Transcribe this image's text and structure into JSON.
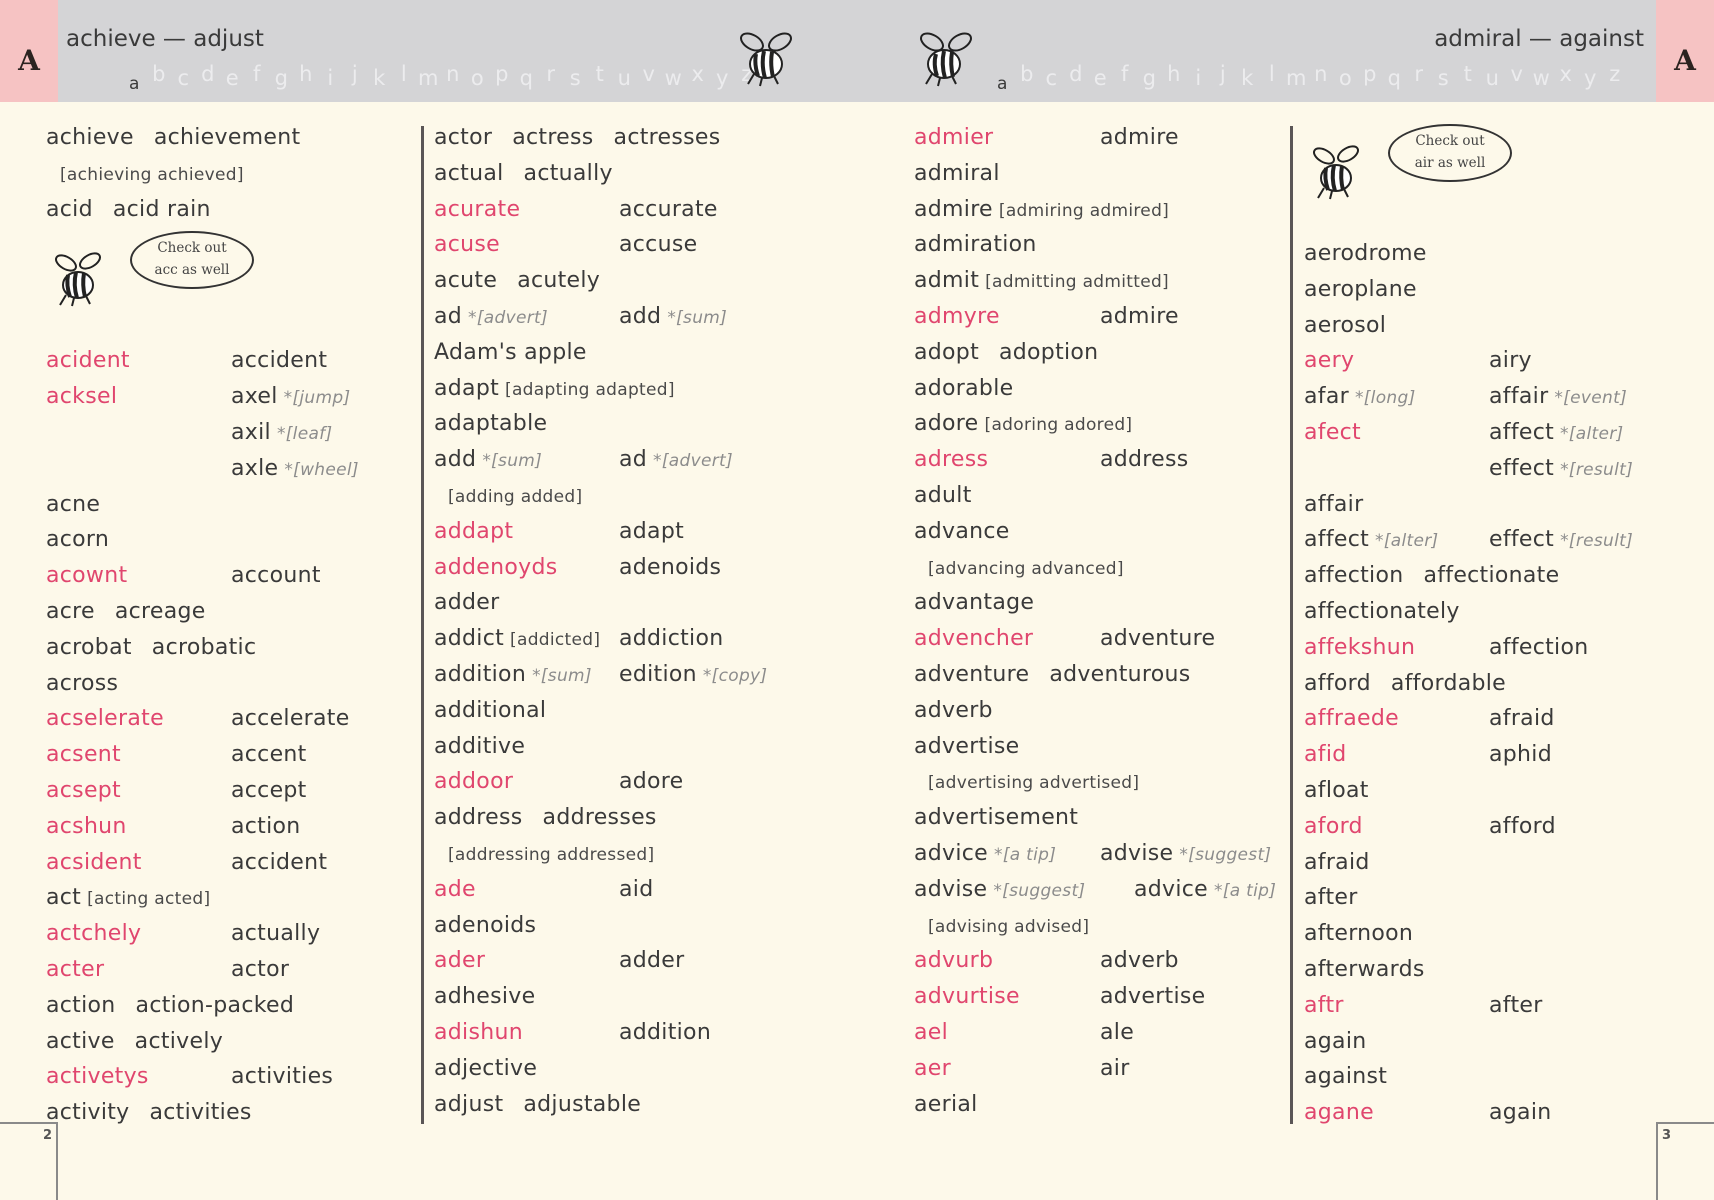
{
  "left_page": {
    "tab_letter": "A",
    "guide_words": "achieve — adjust",
    "alphabet": [
      "a",
      "b",
      "c",
      "d",
      "e",
      "f",
      "g",
      "h",
      "i",
      "j",
      "k",
      "l",
      "m",
      "n",
      "o",
      "p",
      "q",
      "r",
      "s",
      "t",
      "u",
      "v",
      "w",
      "x",
      "y",
      "z"
    ],
    "active_letter": "a",
    "page_number": "2",
    "callout": {
      "line1": "Check out",
      "line2": "acc as well"
    },
    "col1": [
      {
        "type": "multi",
        "words": [
          "achieve",
          "achievement"
        ]
      },
      {
        "type": "sub",
        "forms": "[achieving achieved]"
      },
      {
        "type": "multi",
        "words": [
          "acid",
          "acid rain"
        ]
      },
      {
        "type": "callout"
      },
      {
        "type": "pair",
        "miss": "acident",
        "correct": "accident"
      },
      {
        "type": "pair",
        "miss": "acksel",
        "correct": "axel",
        "note": "*[jump]"
      },
      {
        "type": "pair",
        "miss": "",
        "correct": "axil",
        "note": "*[leaf]"
      },
      {
        "type": "pair",
        "miss": "",
        "correct": "axle",
        "note": "*[wheel]"
      },
      {
        "type": "multi",
        "words": [
          "acne"
        ]
      },
      {
        "type": "multi",
        "words": [
          "acorn"
        ]
      },
      {
        "type": "pair",
        "miss": "acownt",
        "correct": "account"
      },
      {
        "type": "multi",
        "words": [
          "acre",
          "acreage"
        ]
      },
      {
        "type": "multi",
        "words": [
          "acrobat",
          "acrobatic"
        ]
      },
      {
        "type": "multi",
        "words": [
          "across"
        ]
      },
      {
        "type": "pair",
        "miss": "acselerate",
        "correct": "accelerate"
      },
      {
        "type": "pair",
        "miss": "acsent",
        "correct": "accent"
      },
      {
        "type": "pair",
        "miss": "acsept",
        "correct": "accept"
      },
      {
        "type": "pair",
        "miss": "acshun",
        "correct": "action"
      },
      {
        "type": "pair",
        "miss": "acsident",
        "correct": "accident"
      },
      {
        "type": "inline",
        "word": "act",
        "forms": "[acting acted]"
      },
      {
        "type": "pair",
        "miss": "actchely",
        "correct": "actually"
      },
      {
        "type": "pair",
        "miss": "acter",
        "correct": "actor"
      },
      {
        "type": "multi",
        "words": [
          "action",
          "action-packed"
        ]
      },
      {
        "type": "multi",
        "words": [
          "active",
          "actively"
        ]
      },
      {
        "type": "pair",
        "miss": "activetys",
        "correct": "activities"
      },
      {
        "type": "multi",
        "words": [
          "activity",
          "activities"
        ]
      }
    ],
    "col2": [
      {
        "type": "multi",
        "words": [
          "actor",
          "actress",
          "actresses"
        ]
      },
      {
        "type": "multi",
        "words": [
          "actual",
          "actually"
        ]
      },
      {
        "type": "pair",
        "miss": "acurate",
        "correct": "accurate"
      },
      {
        "type": "pair",
        "miss": "acuse",
        "correct": "accuse"
      },
      {
        "type": "multi",
        "words": [
          "acute",
          "acutely"
        ]
      },
      {
        "type": "pairn",
        "left": "ad",
        "left_note": "*[advert]",
        "correct": "add",
        "note": "*[sum]"
      },
      {
        "type": "multi",
        "words": [
          "Adam's apple"
        ]
      },
      {
        "type": "inline",
        "word": "adapt",
        "forms": "[adapting adapted]"
      },
      {
        "type": "multi",
        "words": [
          "adaptable"
        ]
      },
      {
        "type": "pairn",
        "left": "add",
        "left_note": "*[sum]",
        "correct": "ad",
        "note": "*[advert]"
      },
      {
        "type": "sub",
        "forms": "[adding added]"
      },
      {
        "type": "pair",
        "miss": "addapt",
        "correct": "adapt"
      },
      {
        "type": "pair",
        "miss": "addenoyds",
        "correct": "adenoids"
      },
      {
        "type": "multi",
        "words": [
          "adder"
        ]
      },
      {
        "type": "pairf",
        "left": "addict",
        "left_forms": "[addicted]",
        "correct": "addiction"
      },
      {
        "type": "pairn",
        "left": "addition",
        "left_note": "*[sum]",
        "correct": "edition",
        "note": "*[copy]"
      },
      {
        "type": "multi",
        "words": [
          "additional"
        ]
      },
      {
        "type": "multi",
        "words": [
          "additive"
        ]
      },
      {
        "type": "pair",
        "miss": "addoor",
        "correct": "adore"
      },
      {
        "type": "multi",
        "words": [
          "address",
          "addresses"
        ]
      },
      {
        "type": "sub",
        "forms": "[addressing addressed]"
      },
      {
        "type": "pair",
        "miss": "ade",
        "correct": "aid"
      },
      {
        "type": "multi",
        "words": [
          "adenoids"
        ]
      },
      {
        "type": "pair",
        "miss": "ader",
        "correct": "adder"
      },
      {
        "type": "multi",
        "words": [
          "adhesive"
        ]
      },
      {
        "type": "pair",
        "miss": "adishun",
        "correct": "addition"
      },
      {
        "type": "multi",
        "words": [
          "adjective"
        ]
      },
      {
        "type": "multi",
        "words": [
          "adjust",
          "adjustable"
        ]
      }
    ]
  },
  "right_page": {
    "tab_letter": "A",
    "guide_words": "admiral — against",
    "alphabet": [
      "a",
      "b",
      "c",
      "d",
      "e",
      "f",
      "g",
      "h",
      "i",
      "j",
      "k",
      "l",
      "m",
      "n",
      "o",
      "p",
      "q",
      "r",
      "s",
      "t",
      "u",
      "v",
      "w",
      "x",
      "y",
      "z"
    ],
    "active_letter": "a",
    "page_number": "3",
    "callout": {
      "line1": "Check out",
      "line2": "air as well"
    },
    "col3": [
      {
        "type": "pair",
        "miss": "admier",
        "correct": "admire"
      },
      {
        "type": "multi",
        "words": [
          "admiral"
        ]
      },
      {
        "type": "inline",
        "word": "admire",
        "forms": "[admiring admired]"
      },
      {
        "type": "multi",
        "words": [
          "admiration"
        ]
      },
      {
        "type": "inline",
        "word": "admit",
        "forms": "[admitting admitted]"
      },
      {
        "type": "pair",
        "miss": "admyre",
        "correct": "admire"
      },
      {
        "type": "multi",
        "words": [
          "adopt",
          "adoption"
        ]
      },
      {
        "type": "multi",
        "words": [
          "adorable"
        ]
      },
      {
        "type": "inline",
        "word": "adore",
        "forms": "[adoring adored]"
      },
      {
        "type": "pair",
        "miss": "adress",
        "correct": "address"
      },
      {
        "type": "multi",
        "words": [
          "adult"
        ]
      },
      {
        "type": "multi",
        "words": [
          "advance"
        ]
      },
      {
        "type": "sub",
        "forms": "[advancing advanced]"
      },
      {
        "type": "multi",
        "words": [
          "advantage"
        ]
      },
      {
        "type": "pair",
        "miss": "advencher",
        "correct": "adventure"
      },
      {
        "type": "multi",
        "words": [
          "adventure",
          "adventurous"
        ]
      },
      {
        "type": "multi",
        "words": [
          "adverb"
        ]
      },
      {
        "type": "multi",
        "words": [
          "advertise"
        ]
      },
      {
        "type": "sub",
        "forms": "[advertising advertised]"
      },
      {
        "type": "multi",
        "words": [
          "advertisement"
        ]
      },
      {
        "type": "pairn",
        "left": "advice",
        "left_note": "*[a tip]",
        "correct": "advise",
        "note": "*[suggest]"
      },
      {
        "type": "pairn",
        "left": "advise",
        "left_note": "*[suggest]",
        "correct": "advice",
        "note": "*[a tip]",
        "wide": true
      },
      {
        "type": "sub",
        "forms": "[advising advised]"
      },
      {
        "type": "pair",
        "miss": "advurb",
        "correct": "adverb"
      },
      {
        "type": "pair",
        "miss": "advurtise",
        "correct": "advertise"
      },
      {
        "type": "pair",
        "miss": "ael",
        "correct": "ale"
      },
      {
        "type": "pair",
        "miss": "aer",
        "correct": "air"
      },
      {
        "type": "multi",
        "words": [
          "aerial"
        ]
      }
    ],
    "col4": [
      {
        "type": "callout"
      },
      {
        "type": "multi",
        "words": [
          "aerodrome"
        ]
      },
      {
        "type": "multi",
        "words": [
          "aeroplane"
        ]
      },
      {
        "type": "multi",
        "words": [
          "aerosol"
        ]
      },
      {
        "type": "pair",
        "miss": "aery",
        "correct": "airy"
      },
      {
        "type": "pairn",
        "left": "afar",
        "left_note": "*[long]",
        "correct": "affair",
        "note": "*[event]"
      },
      {
        "type": "pair",
        "miss": "afect",
        "correct": "affect",
        "note": "*[alter]"
      },
      {
        "type": "pair",
        "miss": "",
        "correct": "effect",
        "note": "*[result]"
      },
      {
        "type": "multi",
        "words": [
          "affair"
        ]
      },
      {
        "type": "pairn",
        "left": "affect",
        "left_note": "*[alter]",
        "correct": "effect",
        "note": "*[result]"
      },
      {
        "type": "multi",
        "words": [
          "affection",
          "affectionate"
        ]
      },
      {
        "type": "multi",
        "words": [
          "affectionately"
        ]
      },
      {
        "type": "pair",
        "miss": "affekshun",
        "correct": "affection"
      },
      {
        "type": "multi",
        "words": [
          "afford",
          "affordable"
        ]
      },
      {
        "type": "pair",
        "miss": "affraede",
        "correct": "afraid"
      },
      {
        "type": "pair",
        "miss": "afid",
        "correct": "aphid"
      },
      {
        "type": "multi",
        "words": [
          "afloat"
        ]
      },
      {
        "type": "pair",
        "miss": "aford",
        "correct": "afford"
      },
      {
        "type": "multi",
        "words": [
          "afraid"
        ]
      },
      {
        "type": "multi",
        "words": [
          "after"
        ]
      },
      {
        "type": "multi",
        "words": [
          "afternoon"
        ]
      },
      {
        "type": "multi",
        "words": [
          "afterwards"
        ]
      },
      {
        "type": "pair",
        "miss": "aftr",
        "correct": "after"
      },
      {
        "type": "multi",
        "words": [
          "again"
        ]
      },
      {
        "type": "multi",
        "words": [
          "against"
        ]
      },
      {
        "type": "pair",
        "miss": "agane",
        "correct": "again"
      }
    ]
  },
  "colors": {
    "misspelling": "#e0466e",
    "tab": "#f6c3c3",
    "header": "#d4d4d6",
    "paper": "#fdf9ea"
  }
}
